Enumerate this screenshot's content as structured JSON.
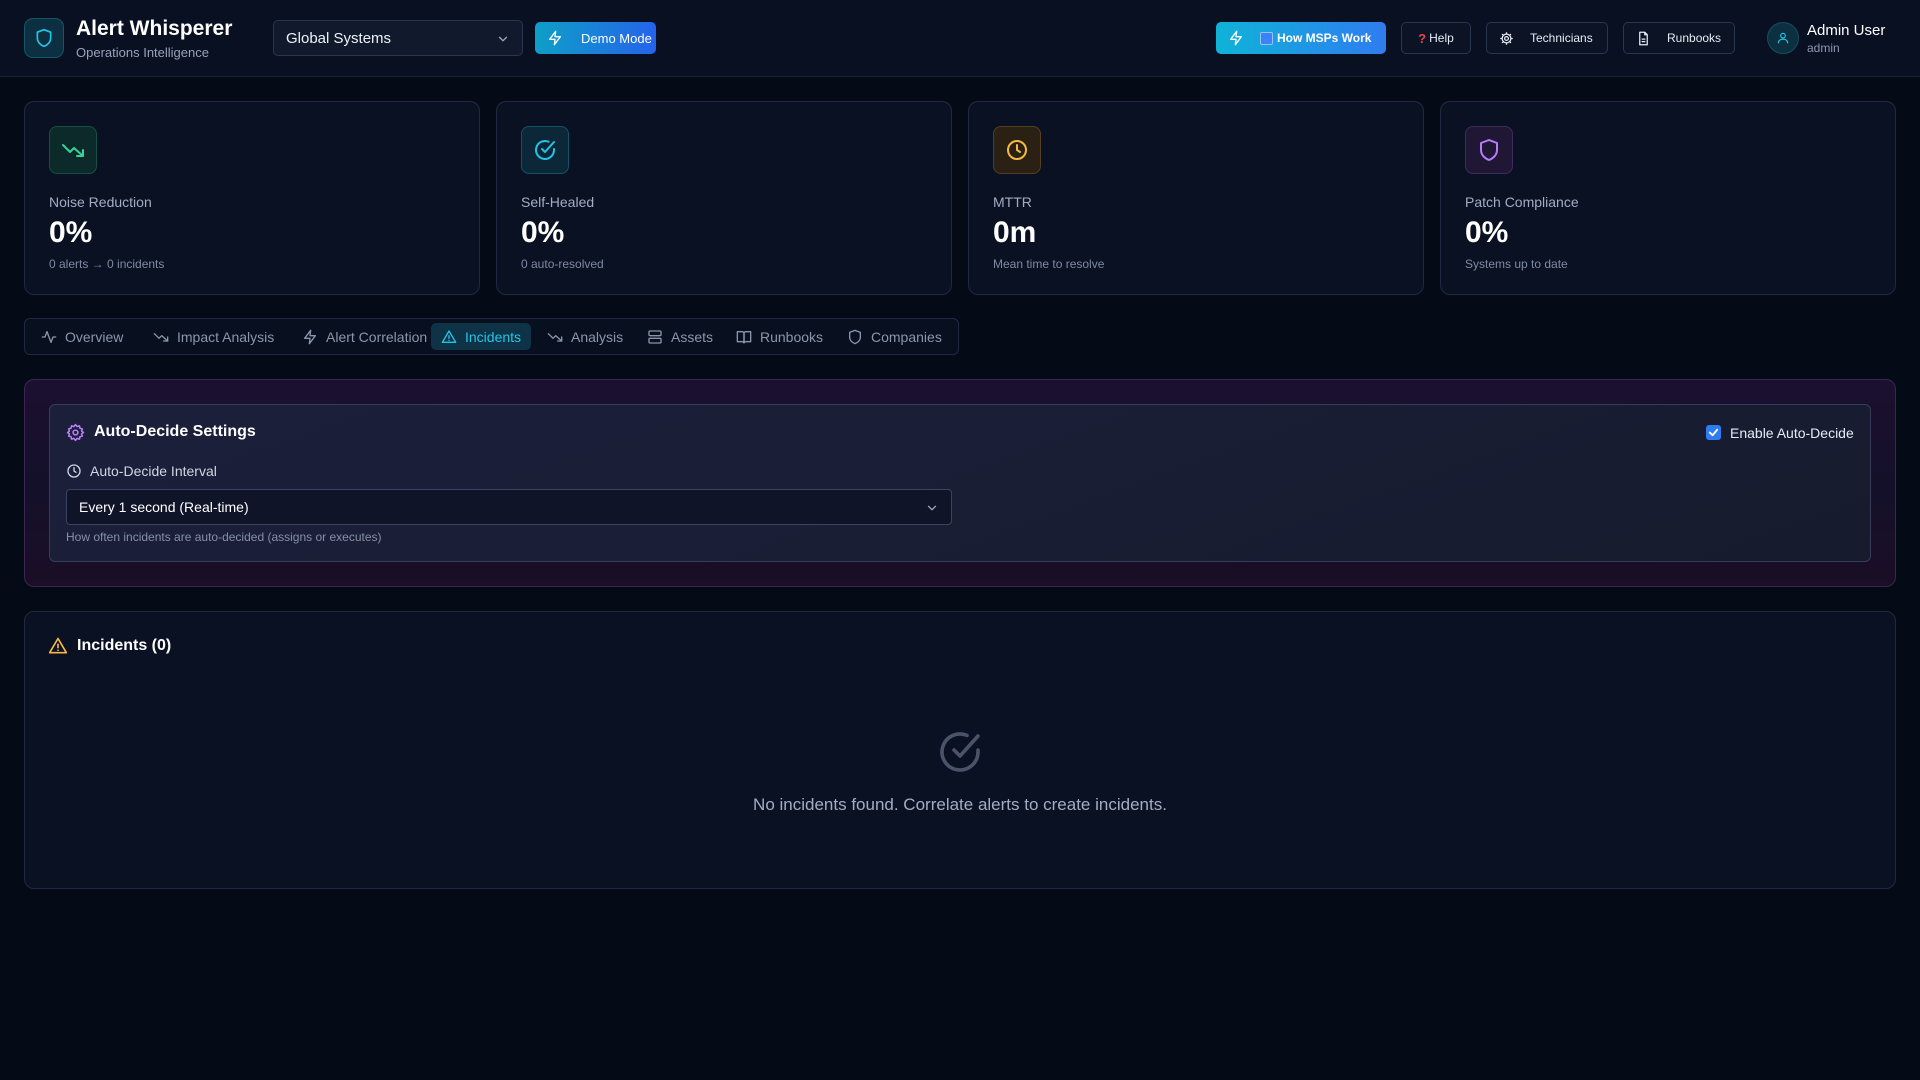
{
  "header": {
    "app_title": "Alert Whisperer",
    "app_subtitle": "Operations Intelligence",
    "org_select_value": "Global Systems",
    "demo_mode_label": "Demo Mode",
    "how_msps_work_label": "How MSPs Work",
    "help_label": "Help",
    "technicians_label": "Technicians",
    "runbooks_label": "Runbooks",
    "user_name": "Admin User",
    "user_role": "admin"
  },
  "stats": [
    {
      "label": "Noise Reduction",
      "value": "0%",
      "sub": "0 alerts → 0 incidents",
      "icon": "trending-down-icon",
      "color": "#34d399"
    },
    {
      "label": "Self-Healed",
      "value": "0%",
      "sub": "0 auto-resolved",
      "icon": "check-circle-icon",
      "color": "#22c5e8"
    },
    {
      "label": "MTTR",
      "value": "0m",
      "sub": "Mean time to resolve",
      "icon": "clock-icon",
      "color": "#f5b942"
    },
    {
      "label": "Patch Compliance",
      "value": "0%",
      "sub": "Systems up to date",
      "icon": "shield-icon",
      "color": "#b77cf7"
    }
  ],
  "tabs": [
    {
      "label": "Overview",
      "icon": "activity-icon",
      "active": false
    },
    {
      "label": "Impact Analysis",
      "icon": "trending-down-icon",
      "active": false
    },
    {
      "label": "Alert Correlation",
      "icon": "zap-icon",
      "active": false
    },
    {
      "label": "Incidents",
      "icon": "alert-triangle-icon",
      "active": true
    },
    {
      "label": "Analysis",
      "icon": "trending-down-icon",
      "active": false
    },
    {
      "label": "Assets",
      "icon": "server-icon",
      "active": false
    },
    {
      "label": "Runbooks",
      "icon": "book-open-icon",
      "active": false
    },
    {
      "label": "Companies",
      "icon": "shield-icon",
      "active": false
    }
  ],
  "auto_decide": {
    "title": "Auto-Decide Settings",
    "enable_label": "Enable Auto-Decide",
    "enabled": true,
    "interval_label": "Auto-Decide Interval",
    "interval_value": "Every 1 second (Real-time)",
    "help_text": "How often incidents are auto-decided (assigns or executes)"
  },
  "incidents": {
    "title": "Incidents (0)",
    "empty_message": "No incidents found. Correlate alerts to create incidents."
  },
  "colors": {
    "accent": "#22c5e8",
    "brand_gradient_start": "#0e9fc7",
    "brand_gradient_end": "#2563eb",
    "warning": "#f5b942",
    "purple": "#b77cf7"
  }
}
